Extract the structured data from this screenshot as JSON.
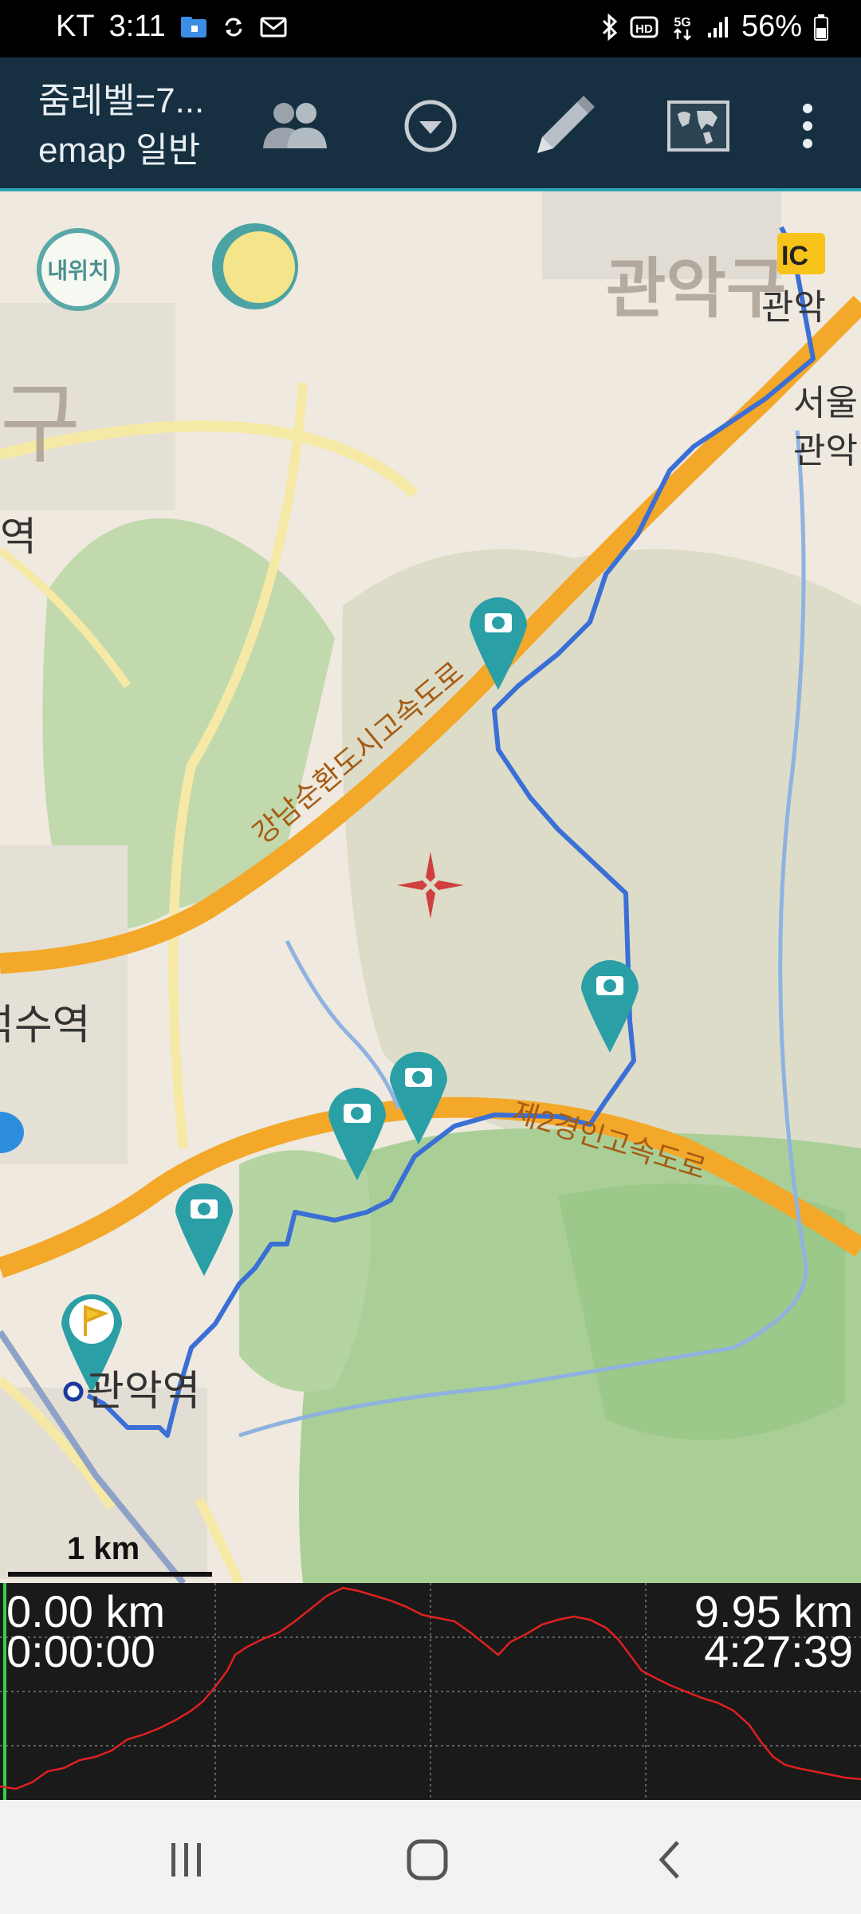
{
  "status_bar": {
    "carrier": "KT",
    "time": "3:11",
    "battery": "56%",
    "icons": [
      "folder-icon",
      "sync-icon",
      "mail-icon",
      "bluetooth-icon",
      "hd-voice-icon",
      "5g-icon",
      "signal-icon",
      "battery-icon"
    ]
  },
  "header": {
    "zoom_level": "줌레벨=7...",
    "map_type": "emap 일반",
    "buttons": [
      "group-icon",
      "dropdown-icon",
      "pencil-icon",
      "world-map-icon",
      "more-vert-icon"
    ]
  },
  "map": {
    "my_location_label": "내위치",
    "scale_label": "1 km",
    "labels": {
      "gwanak_gu": "관악구",
      "gwanak": "관악",
      "seoul": "서울",
      "gwanak2": "관악",
      "gu": "구",
      "yeok": "역",
      "sinsu_station": "석수역",
      "gwanak_station": "관악역",
      "ic": "IC",
      "expressway1": "강남순환도시고속도로",
      "expressway2": "제2경인고속도로"
    },
    "colors": {
      "route": "#3b6fd6",
      "marker": "#2a9fa6",
      "road": "#f3a829",
      "forest": "#a9cf96"
    }
  },
  "graph": {
    "start_distance": "0.00 km",
    "start_time": "0:00:00",
    "end_distance": "9.95 km",
    "end_time": "4:27:39"
  },
  "nav_bar": {
    "buttons": [
      "recent-apps-icon",
      "home-icon",
      "back-icon"
    ]
  }
}
